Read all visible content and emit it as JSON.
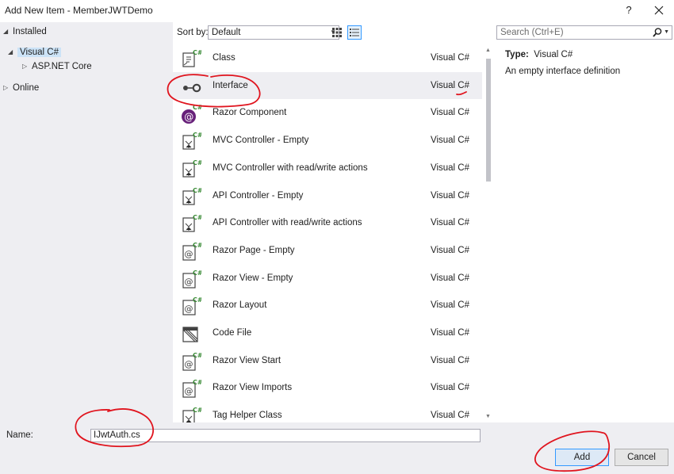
{
  "window": {
    "title": "Add New Item - MemberJWTDemo",
    "help_label": "?",
    "close_icon": "close-icon"
  },
  "tree": {
    "installed": "Installed",
    "visual_csharp": "Visual C#",
    "aspnet_core": "ASP.NET Core",
    "online": "Online"
  },
  "toolbar": {
    "sort_label": "Sort by:",
    "sort_value": "Default",
    "search_placeholder": "Search (Ctrl+E)"
  },
  "items": [
    {
      "name": "Class",
      "lang": "Visual C#",
      "icon": "class-icon"
    },
    {
      "name": "Interface",
      "lang": "Visual C#",
      "icon": "interface-icon"
    },
    {
      "name": "Razor Component",
      "lang": "Visual C#",
      "icon": "razor-component-icon"
    },
    {
      "name": "MVC Controller - Empty",
      "lang": "Visual C#",
      "icon": "controller-icon"
    },
    {
      "name": "MVC Controller with read/write actions",
      "lang": "Visual C#",
      "icon": "controller-icon"
    },
    {
      "name": "API Controller - Empty",
      "lang": "Visual C#",
      "icon": "controller-icon"
    },
    {
      "name": "API Controller with read/write actions",
      "lang": "Visual C#",
      "icon": "controller-icon"
    },
    {
      "name": "Razor Page - Empty",
      "lang": "Visual C#",
      "icon": "razor-file-icon"
    },
    {
      "name": "Razor View - Empty",
      "lang": "Visual C#",
      "icon": "razor-file-icon"
    },
    {
      "name": "Razor Layout",
      "lang": "Visual C#",
      "icon": "razor-file-icon"
    },
    {
      "name": "Code File",
      "lang": "Visual C#",
      "icon": "code-file-icon"
    },
    {
      "name": "Razor View Start",
      "lang": "Visual C#",
      "icon": "razor-file-icon"
    },
    {
      "name": "Razor View Imports",
      "lang": "Visual C#",
      "icon": "razor-file-icon"
    },
    {
      "name": "Tag Helper Class",
      "lang": "Visual C#",
      "icon": "controller-icon"
    }
  ],
  "selected_item": "Interface",
  "details": {
    "type_label": "Type:",
    "type_value": "Visual C#",
    "description": "An empty interface definition"
  },
  "footer": {
    "name_label": "Name:",
    "name_value": "IJwtAuth.cs",
    "add_label": "Add",
    "cancel_label": "Cancel"
  },
  "colors": {
    "selection": "#cce3f7",
    "pane_background": "#eeeef2",
    "annotation_red": "#e0141e",
    "csharp_green": "#388a34",
    "razor_purple": "#68217a"
  }
}
